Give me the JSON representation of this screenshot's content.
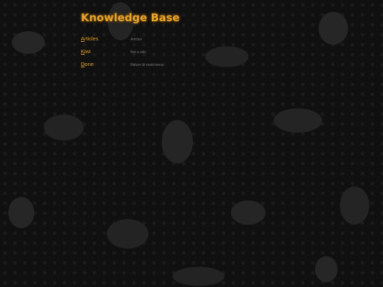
{
  "page": {
    "title": "Knowledge Base"
  },
  "menu": {
    "items": [
      {
        "hotkey": "A",
        "rest": "rticles",
        "description": "Articles"
      },
      {
        "hotkey": "K",
        "rest": "iwi",
        "description": "Not a wiki"
      },
      {
        "hotkey": "D",
        "rest": "one",
        "description": "Return to main menu"
      }
    ]
  },
  "theme": {
    "accent": "#e5a42c",
    "description_text": "#777777",
    "background": "#101010"
  }
}
